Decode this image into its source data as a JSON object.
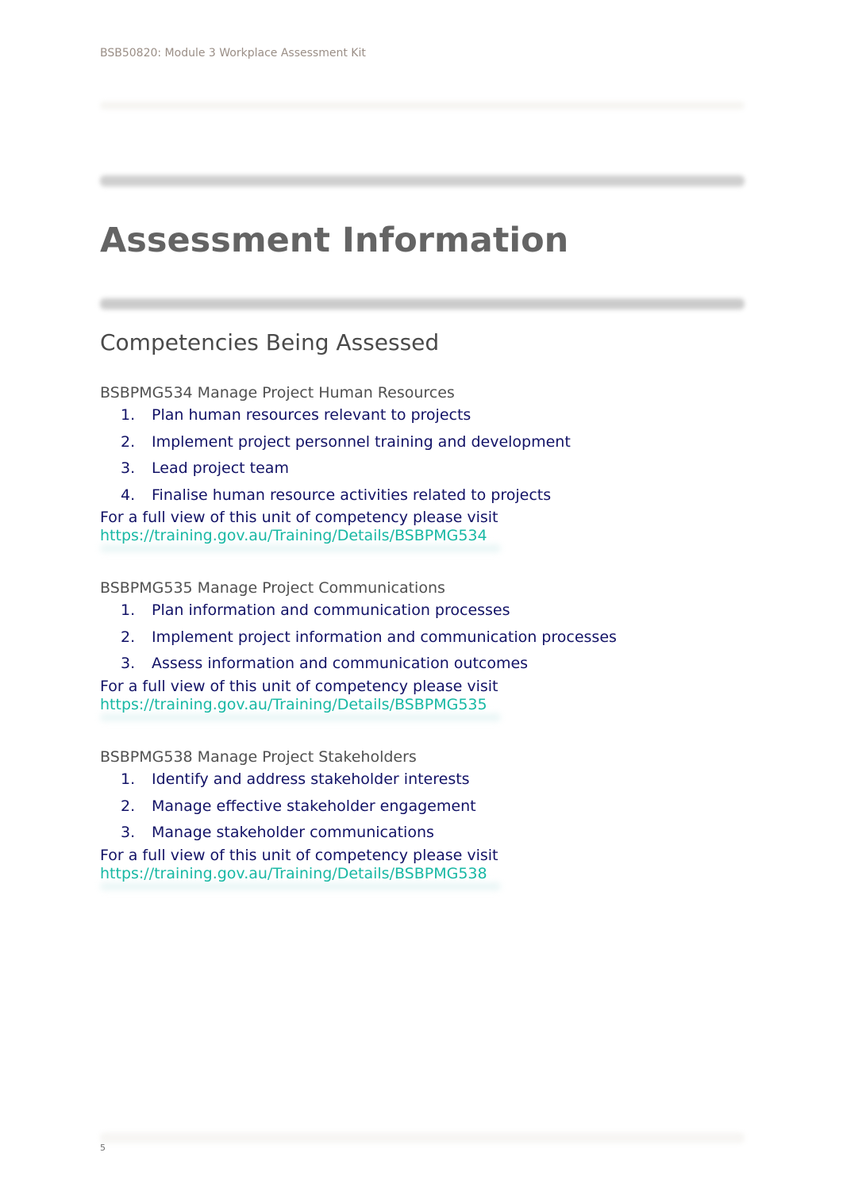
{
  "header": {
    "text": "BSB50820: Module 3 Workplace Assessment Kit"
  },
  "title": "Assessment Information",
  "subtitle": "Competencies Being Assessed",
  "colors": {
    "title": "#646464",
    "list_text": "#121266",
    "link": "#18b8a4",
    "header": "#9a8e86"
  },
  "units": [
    {
      "title": "BSBPMG534 Manage Project Human Resources",
      "items": [
        {
          "num": "1.",
          "text": "Plan human resources relevant to projects"
        },
        {
          "num": "2.",
          "text": "Implement project personnel training and development"
        },
        {
          "num": "3.",
          "text": "Lead project team"
        },
        {
          "num": "4.",
          "text": "Finalise human resource activities related to projects"
        }
      ],
      "visit_text": "For a full view of this unit of competency please visit",
      "link": "https://training.gov.au/Training/Details/BSBPMG534"
    },
    {
      "title": "BSBPMG535 Manage Project Communications",
      "items": [
        {
          "num": "1.",
          "text": "Plan information and communication processes"
        },
        {
          "num": "2.",
          "text": "Implement project information and communication processes"
        },
        {
          "num": "3.",
          "text": "Assess information and communication outcomes"
        }
      ],
      "visit_text": "For a full view of this unit of competency please visit",
      "link": "https://training.gov.au/Training/Details/BSBPMG535"
    },
    {
      "title": "BSBPMG538 Manage Project Stakeholders",
      "items": [
        {
          "num": "1.",
          "text": "Identify and address stakeholder interests"
        },
        {
          "num": "2.",
          "text": "Manage effective stakeholder engagement"
        },
        {
          "num": "3.",
          "text": "Manage stakeholder communications"
        }
      ],
      "visit_text": "For a full view of this unit of competency please visit",
      "link": "https://training.gov.au/Training/Details/BSBPMG538"
    }
  ],
  "footer": {
    "page_number": "5"
  }
}
